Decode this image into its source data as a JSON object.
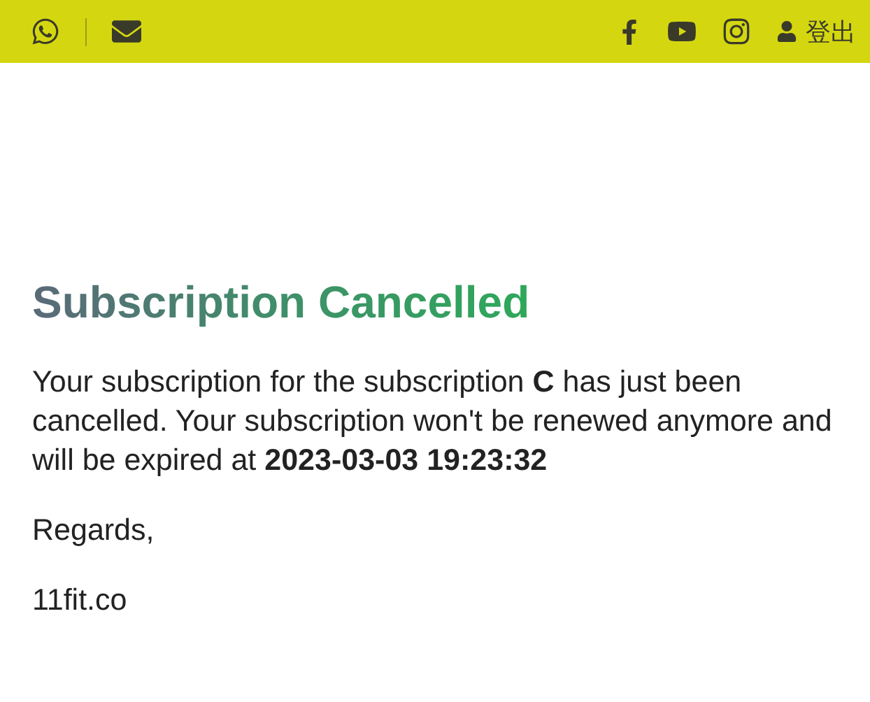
{
  "top_bar": {
    "logout_label": "登出"
  },
  "heading": "Subscription Cancelled",
  "message": "Your subscription for the subscription **C** has just been cancelled. Your subscription won't be renewed anymore and will be expired at **2023-03-03 19:23:32**",
  "closing": "Regards,",
  "signature": "11fit.co"
}
